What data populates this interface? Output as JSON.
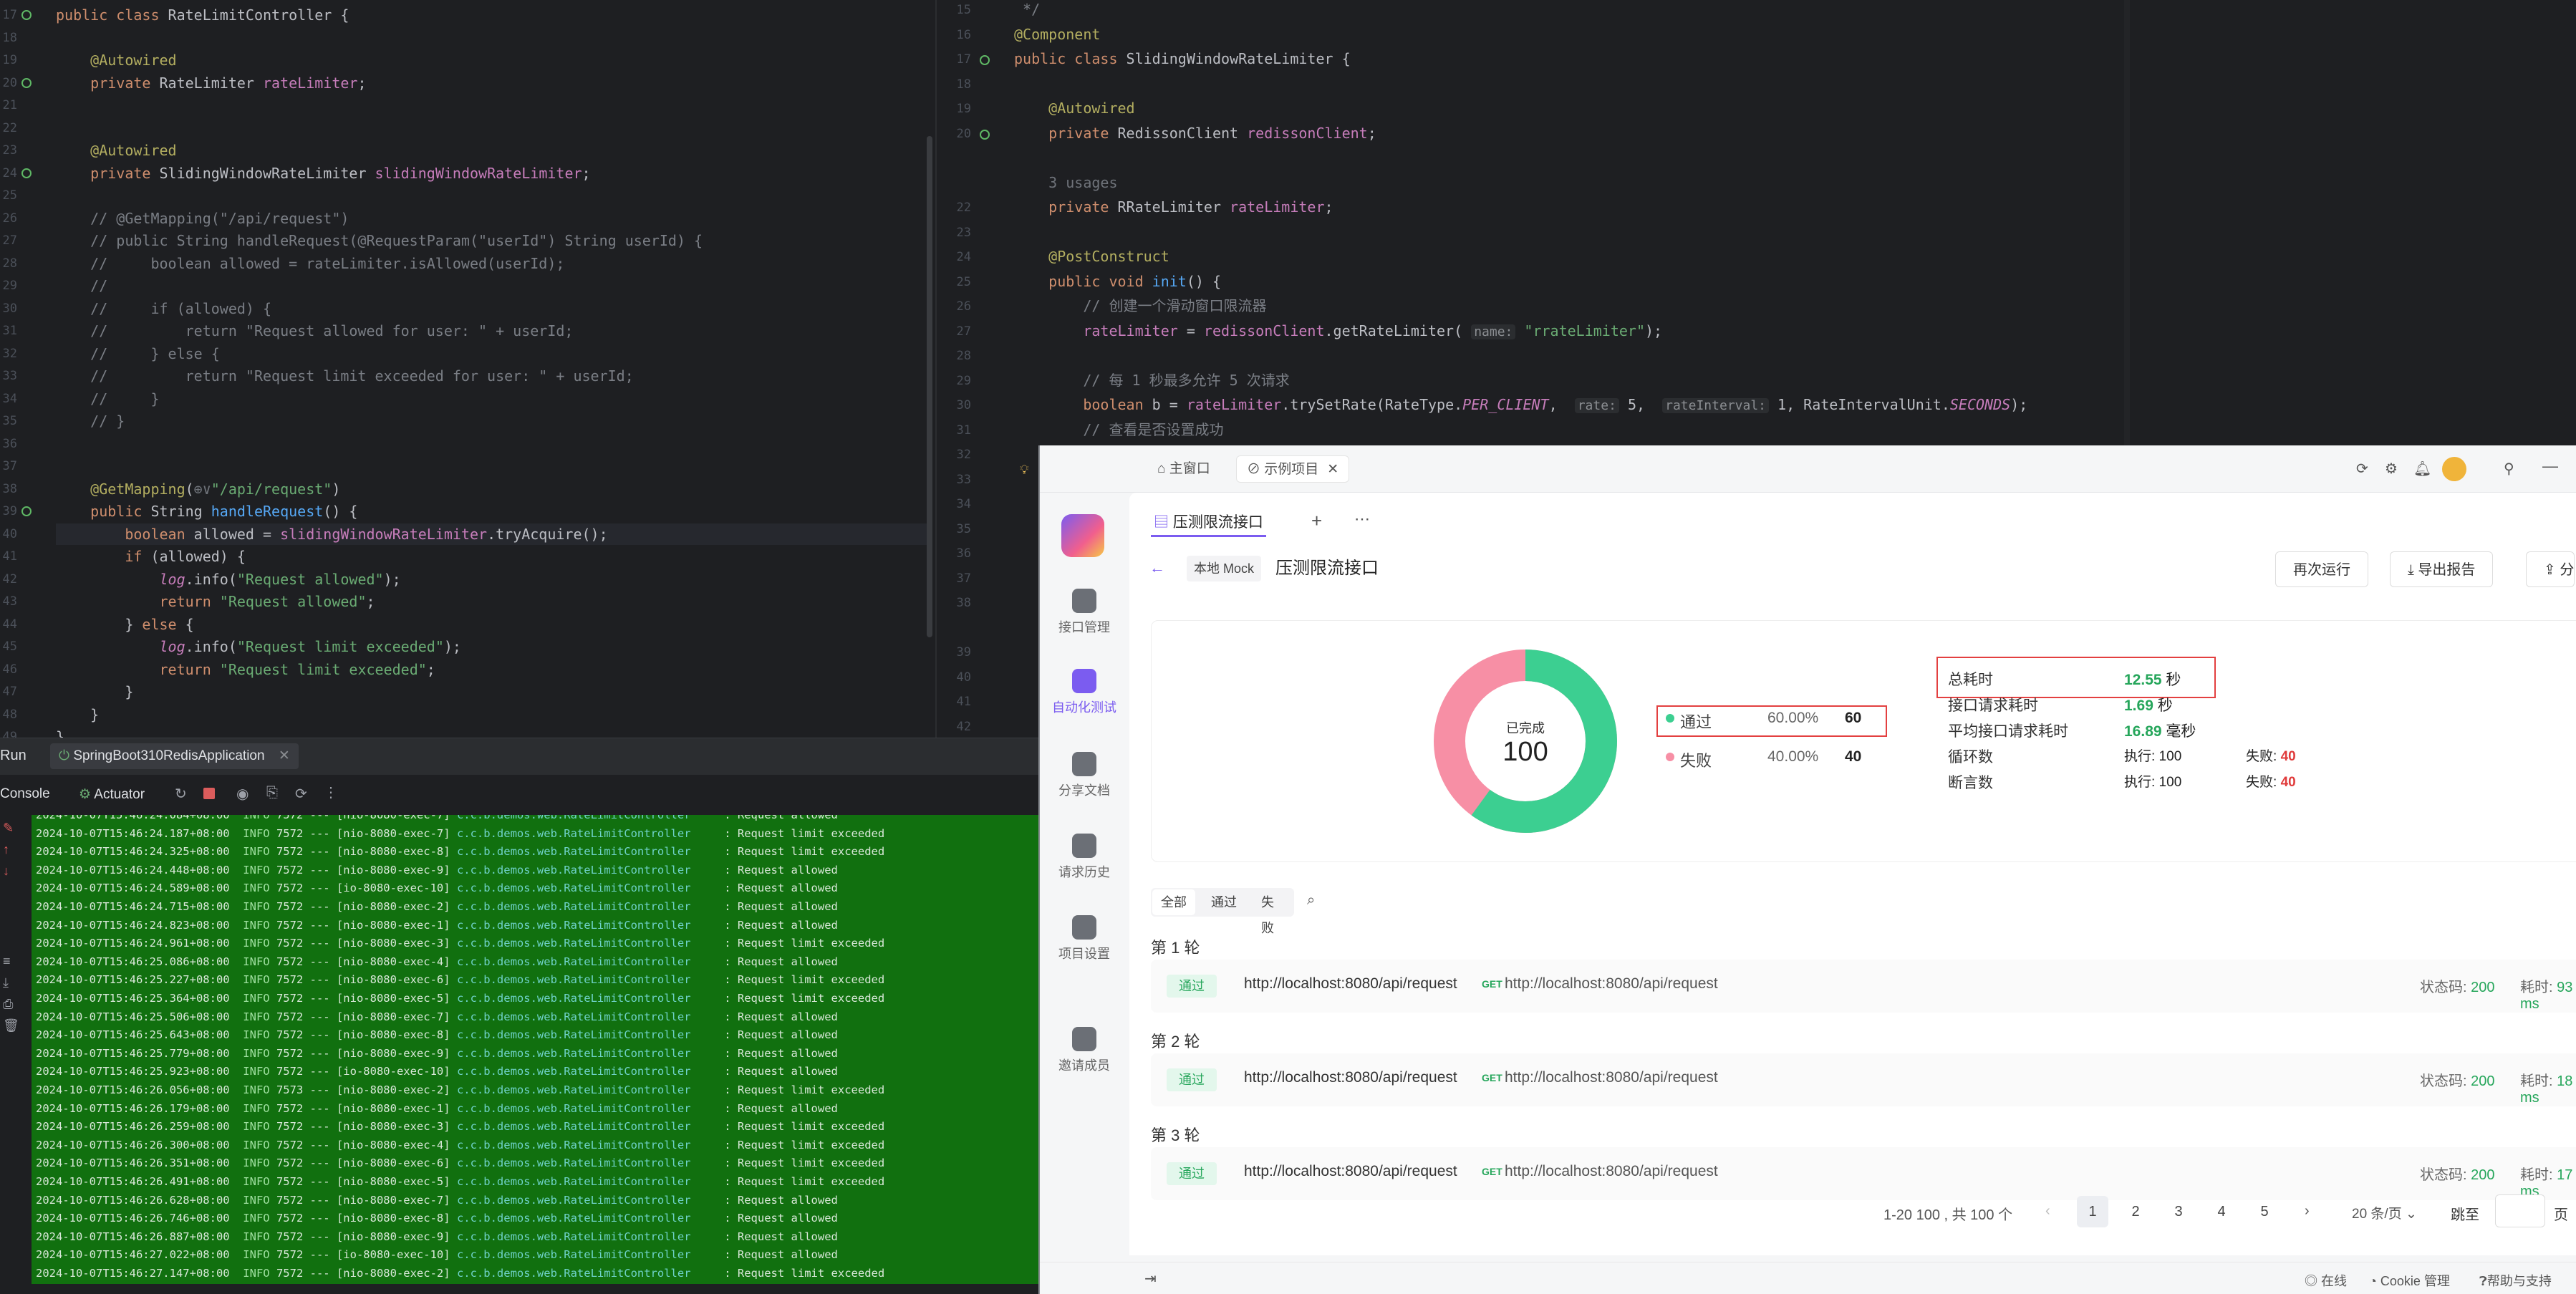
{
  "left_editor": {
    "lines": [
      {
        "n": "17",
        "html": "<span class='kw'>public class</span> RateLimitController {"
      },
      {
        "n": "18",
        "html": ""
      },
      {
        "n": "19",
        "html": "    <span class='ann'>@Autowired</span>"
      },
      {
        "n": "20",
        "html": "    <span class='kw'>private</span> RateLimiter <span class='fld'>rateLimiter</span>;"
      },
      {
        "n": "21",
        "html": ""
      },
      {
        "n": "22",
        "html": ""
      },
      {
        "n": "23",
        "html": "    <span class='ann'>@Autowired</span>"
      },
      {
        "n": "24",
        "html": "    <span class='kw'>private</span> SlidingWindowRateLimiter <span class='fld'>slidingWindowRateLimiter</span>;"
      },
      {
        "n": "25",
        "html": ""
      },
      {
        "n": "26",
        "html": "<span class='cmt'>    // @GetMapping(\"/api/request\")</span>"
      },
      {
        "n": "27",
        "html": "<span class='cmt'>    // public String handleRequest(@RequestParam(\"userId\") String userId) {</span>"
      },
      {
        "n": "28",
        "html": "<span class='cmt'>    //     boolean allowed = rateLimiter.isAllowed(userId);</span>"
      },
      {
        "n": "29",
        "html": "<span class='cmt'>    //</span>"
      },
      {
        "n": "30",
        "html": "<span class='cmt'>    //     if (allowed) {</span>"
      },
      {
        "n": "31",
        "html": "<span class='cmt'>    //         return \"Request allowed for user: \" + userId;</span>"
      },
      {
        "n": "32",
        "html": "<span class='cmt'>    //     } else {</span>"
      },
      {
        "n": "33",
        "html": "<span class='cmt'>    //         return \"Request limit exceeded for user: \" + userId;</span>"
      },
      {
        "n": "34",
        "html": "<span class='cmt'>    //     }</span>"
      },
      {
        "n": "35",
        "html": "<span class='cmt'>    // }</span>"
      },
      {
        "n": "36",
        "html": ""
      },
      {
        "n": "37",
        "html": ""
      },
      {
        "n": "38",
        "html": "    <span class='ann'>@GetMapping</span>(<span class='gray'>⊕∨</span><span class='str'>\"/api/request\"</span>)"
      },
      {
        "n": "39",
        "html": "    <span class='kw'>public</span> String <span class='fn'>handleRequest</span>() {"
      },
      {
        "n": "40",
        "html": "        <span class='kw'>boolean</span> allowed = <span class='fld'>slidingWindowRateLimiter</span>.tryAcquire();"
      },
      {
        "n": "41",
        "html": "        <span class='kw'>if</span> (allowed) {"
      },
      {
        "n": "42",
        "html": "            <span class='fld it'>log</span>.info(<span class='str'>\"Request allowed\"</span>);"
      },
      {
        "n": "43",
        "html": "            <span class='kw'>return</span> <span class='str'>\"Request allowed\"</span>;"
      },
      {
        "n": "44",
        "html": "        } <span class='kw'>else</span> {"
      },
      {
        "n": "45",
        "html": "            <span class='fld it'>log</span>.info(<span class='str'>\"Request limit exceeded\"</span>);"
      },
      {
        "n": "46",
        "html": "            <span class='kw'>return</span> <span class='str'>\"Request limit exceeded\"</span>;"
      },
      {
        "n": "47",
        "html": "        }"
      },
      {
        "n": "48",
        "html": "    }"
      },
      {
        "n": "49",
        "html": "}"
      }
    ]
  },
  "right_editor": {
    "lines": [
      {
        "n": "15",
        "html": "<span class='cmt'> */</span>",
        "y": 0
      },
      {
        "n": "16",
        "html": "<span class='ann'>@Component</span>",
        "y": 1
      },
      {
        "n": "17",
        "html": "<span class='kw'>public class</span> SlidingWindowRateLimiter {",
        "y": 2
      },
      {
        "n": "18",
        "html": "",
        "y": 3
      },
      {
        "n": "19",
        "html": "    <span class='ann'>@Autowired</span>",
        "y": 4
      },
      {
        "n": "20",
        "html": "    <span class='kw'>private</span> RedissonClient <span class='fld'>redissonClient</span>;",
        "y": 5
      },
      {
        "n": "",
        "html": "",
        "y": 6
      },
      {
        "n": "",
        "html": "    <span class='gray'>3 usages</span>",
        "y": 7
      },
      {
        "n": "22",
        "html": "    <span class='kw'>private</span> RRateLimiter <span class='fld'>rateLimiter</span>;",
        "y": 8
      },
      {
        "n": "23",
        "html": "",
        "y": 9
      },
      {
        "n": "24",
        "html": "    <span class='ann'>@PostConstruct</span>",
        "y": 10
      },
      {
        "n": "25",
        "html": "    <span class='kw'>public void</span> <span class='fn'>init</span>() {",
        "y": 11
      },
      {
        "n": "26",
        "html": "        <span class='cmt'>// 创建一个滑动窗口限流器</span>",
        "y": 12
      },
      {
        "n": "27",
        "html": "        <span class='fld'>rateLimiter</span> = <span class='fld'>redissonClient</span>.getRateLimiter( <span class='hint'>name:</span> <span class='str'>\"rrateLimiter\"</span>);",
        "y": 13
      },
      {
        "n": "28",
        "html": "",
        "y": 14
      },
      {
        "n": "29",
        "html": "        <span class='cmt'>// 每 1 秒最多允许 5 次请求</span>",
        "y": 15
      },
      {
        "n": "30",
        "html": "        <span class='kw'>boolean</span> b = <span class='fld'>rateLimiter</span>.trySetRate(RateType.<span class='cst'>PER_CLIENT</span>,  <span class='hint'>rate:</span> 5,  <span class='hint'>rateInterval:</span> 1, RateIntervalUnit.<span class='cst'>SECONDS</span>);",
        "y": 16
      },
      {
        "n": "31",
        "html": "        <span class='cmt'>// 查看是否设置成功</span>",
        "y": 17
      },
      {
        "n": "32",
        "html": "        <span class='kw'>if</span> (b){",
        "y": 18
      },
      {
        "n": "33",
        "html": "",
        "y": 19
      },
      {
        "n": "34",
        "html": "",
        "y": 20
      },
      {
        "n": "35",
        "html": "",
        "y": 21
      },
      {
        "n": "36",
        "html": "",
        "y": 22
      },
      {
        "n": "37",
        "html": "",
        "y": 23
      },
      {
        "n": "38",
        "html": "",
        "y": 24
      },
      {
        "n": "39",
        "html": "",
        "y": 26
      },
      {
        "n": "40",
        "html": "",
        "y": 27
      },
      {
        "n": "41",
        "html": "",
        "y": 28
      },
      {
        "n": "42",
        "html": "",
        "y": 29
      }
    ]
  },
  "run_panel": {
    "run_label": "Run",
    "tab_label": "SpringBoot310RedisApplication",
    "console_label": "Console",
    "actuator_label": "Actuator",
    "log_lines": [
      [
        "2024-10-07T15:46:24.084+08:00",
        "7572",
        "[nio-8080-exec-7]",
        "Request allowed"
      ],
      [
        "2024-10-07T15:46:24.187+08:00",
        "7572",
        "[nio-8080-exec-7]",
        "Request limit exceeded"
      ],
      [
        "2024-10-07T15:46:24.325+08:00",
        "7572",
        "[nio-8080-exec-8]",
        "Request limit exceeded"
      ],
      [
        "2024-10-07T15:46:24.448+08:00",
        "7572",
        "[nio-8080-exec-9]",
        "Request allowed"
      ],
      [
        "2024-10-07T15:46:24.589+08:00",
        "7572",
        "[io-8080-exec-10]",
        "Request allowed"
      ],
      [
        "2024-10-07T15:46:24.715+08:00",
        "7572",
        "[nio-8080-exec-2]",
        "Request allowed"
      ],
      [
        "2024-10-07T15:46:24.823+08:00",
        "7572",
        "[nio-8080-exec-1]",
        "Request allowed"
      ],
      [
        "2024-10-07T15:46:24.961+08:00",
        "7572",
        "[nio-8080-exec-3]",
        "Request limit exceeded"
      ],
      [
        "2024-10-07T15:46:25.086+08:00",
        "7572",
        "[nio-8080-exec-4]",
        "Request allowed"
      ],
      [
        "2024-10-07T15:46:25.227+08:00",
        "7572",
        "[nio-8080-exec-6]",
        "Request limit exceeded"
      ],
      [
        "2024-10-07T15:46:25.364+08:00",
        "7572",
        "[nio-8080-exec-5]",
        "Request limit exceeded"
      ],
      [
        "2024-10-07T15:46:25.506+08:00",
        "7572",
        "[nio-8080-exec-7]",
        "Request allowed"
      ],
      [
        "2024-10-07T15:46:25.643+08:00",
        "7572",
        "[nio-8080-exec-8]",
        "Request allowed"
      ],
      [
        "2024-10-07T15:46:25.779+08:00",
        "7572",
        "[nio-8080-exec-9]",
        "Request allowed"
      ],
      [
        "2024-10-07T15:46:25.923+08:00",
        "7572",
        "[io-8080-exec-10]",
        "Request allowed"
      ],
      [
        "2024-10-07T15:46:26.056+08:00",
        "7573",
        "[nio-8080-exec-2]",
        "Request limit exceeded"
      ],
      [
        "2024-10-07T15:46:26.179+08:00",
        "7572",
        "[nio-8080-exec-1]",
        "Request allowed"
      ],
      [
        "2024-10-07T15:46:26.259+08:00",
        "7572",
        "[nio-8080-exec-3]",
        "Request limit exceeded"
      ],
      [
        "2024-10-07T15:46:26.300+08:00",
        "7572",
        "[nio-8080-exec-4]",
        "Request limit exceeded"
      ],
      [
        "2024-10-07T15:46:26.351+08:00",
        "7572",
        "[nio-8080-exec-6]",
        "Request limit exceeded"
      ],
      [
        "2024-10-07T15:46:26.491+08:00",
        "7572",
        "[nio-8080-exec-5]",
        "Request limit exceeded"
      ],
      [
        "2024-10-07T15:46:26.628+08:00",
        "7572",
        "[nio-8080-exec-7]",
        "Request allowed"
      ],
      [
        "2024-10-07T15:46:26.746+08:00",
        "7572",
        "[nio-8080-exec-8]",
        "Request allowed"
      ],
      [
        "2024-10-07T15:46:26.887+08:00",
        "7572",
        "[nio-8080-exec-9]",
        "Request allowed"
      ],
      [
        "2024-10-07T15:46:27.022+08:00",
        "7572",
        "[io-8080-exec-10]",
        "Request allowed"
      ],
      [
        "2024-10-07T15:46:27.147+08:00",
        "7572",
        "[nio-8080-exec-2]",
        "Request limit exceeded"
      ]
    ],
    "log_level": "INFO",
    "log_sep": "---",
    "log_class": "c.c.b.demos.web.RateLimitController",
    "log_colon": ":"
  },
  "apifox": {
    "tabs": {
      "main_window": "主窗口",
      "example_project": "示例项目"
    },
    "sidebar": [
      {
        "label": "接口管理",
        "icon": "api-icon"
      },
      {
        "label": "自动化测试",
        "icon": "automation-icon"
      },
      {
        "label": "分享文档",
        "icon": "book-icon"
      },
      {
        "label": "请求历史",
        "icon": "history-icon"
      },
      {
        "label": "项目设置",
        "icon": "settings-icon"
      },
      {
        "label": "邀请成员",
        "icon": "invite-icon"
      }
    ],
    "doc_tab": "压测限流接口",
    "env_label": "本地 Mock",
    "page_title": "压测限流接口",
    "rerun_button": "再次运行",
    "export_button": "导出报告",
    "share_button": "分",
    "donut": {
      "caption": "已完成",
      "total": "100",
      "pass_pct": 0.6,
      "pass_color": "#3ccf91",
      "fail_color": "#f78fa5"
    },
    "legend": {
      "pass_label": "通过",
      "pass_pct": "60.00%",
      "pass_count": "60",
      "fail_label": "失败",
      "fail_pct": "40.00%",
      "fail_count": "40"
    },
    "stats": {
      "total_time_label": "总耗时",
      "total_time": "12.55",
      "total_time_unit": "秒",
      "req_time_label": "接口请求耗时",
      "req_time": "1.69",
      "req_time_unit": "秒",
      "avg_time_label": "平均接口请求耗时",
      "avg_time": "16.89",
      "avg_time_unit": "毫秒",
      "loop_label": "循环数",
      "loop_exec": "执行: 100",
      "loop_fail_label": "失败:",
      "loop_fail": "40",
      "assert_label": "断言数",
      "assert_exec": "执行: 100",
      "assert_fail_label": "失败:",
      "assert_fail": "40"
    },
    "filters": {
      "all": "全部",
      "pass": "通过",
      "fail": "失败"
    },
    "rounds": [
      {
        "title": "第 1 轮",
        "badge": "通过",
        "url": "http://localhost:8080/api/request",
        "method": "GET",
        "url2": "http://localhost:8080/api/request",
        "status_label": "状态码:",
        "status": "200",
        "time_label": "耗时:",
        "time": "93 ms"
      },
      {
        "title": "第 2 轮",
        "badge": "通过",
        "url": "http://localhost:8080/api/request",
        "method": "GET",
        "url2": "http://localhost:8080/api/request",
        "status_label": "状态码:",
        "status": "200",
        "time_label": "耗时:",
        "time": "18 ms"
      },
      {
        "title": "第 3 轮",
        "badge": "通过",
        "url": "http://localhost:8080/api/request",
        "method": "GET",
        "url2": "http://localhost:8080/api/request",
        "status_label": "状态码:",
        "status": "200",
        "time_label": "耗时:",
        "time": "17 ms"
      }
    ],
    "pagination": {
      "summary": "1-20 100 , 共 100 个",
      "pages": [
        "1",
        "2",
        "3",
        "4",
        "5"
      ],
      "page_size": "20 条/页",
      "jump_label": "跳至",
      "page_suffix": "页"
    },
    "footer": {
      "online": "在线",
      "cookie": "Cookie 管理",
      "help": "帮助与支持"
    }
  }
}
